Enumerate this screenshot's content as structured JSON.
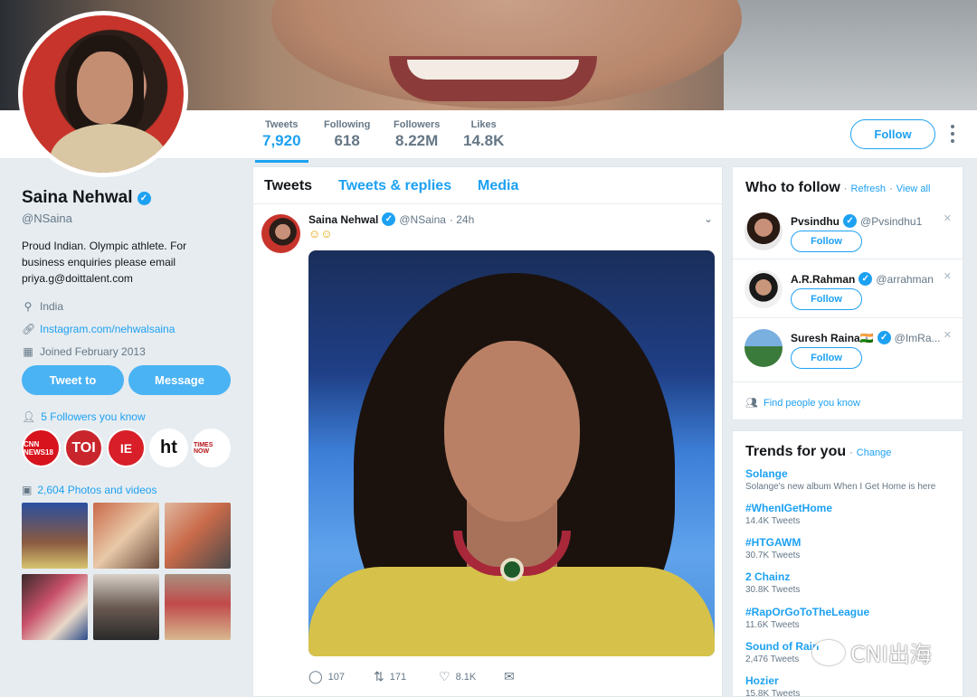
{
  "profile": {
    "name": "Saina Nehwal",
    "handle": "@NSaina",
    "bio": "Proud Indian. Olympic athlete. For business enquiries please email priya.g@doittalent.com",
    "location": "India",
    "website": "Instagram.com/nehwalsaina",
    "joined": "Joined February 2013",
    "tweet_to_label": "Tweet to",
    "message_label": "Message",
    "followers_you_know": "5 Followers you know",
    "photos_videos": "2,604 Photos and videos",
    "badges": [
      "CNN NEWS18",
      "TOI",
      "IE",
      "ht",
      "TIMES NOW"
    ]
  },
  "stats": [
    {
      "label": "Tweets",
      "value": "7,920"
    },
    {
      "label": "Following",
      "value": "618"
    },
    {
      "label": "Followers",
      "value": "8.22M"
    },
    {
      "label": "Likes",
      "value": "14.8K"
    }
  ],
  "follow_label": "Follow",
  "timeline": {
    "tabs": [
      "Tweets",
      "Tweets & replies",
      "Media"
    ],
    "tweet": {
      "name": "Saina Nehwal",
      "handle": "@NSaina",
      "time": "· 24h",
      "text": "☺☺",
      "replies": "107",
      "retweets": "171",
      "likes": "8.1K"
    }
  },
  "who_to_follow": {
    "title": "Who to follow",
    "refresh": "Refresh",
    "view_all": "View all",
    "sep": "·",
    "users": [
      {
        "name": "Pvsindhu",
        "handle": "@Pvsindhu1",
        "follow": "Follow"
      },
      {
        "name": "A.R.Rahman",
        "handle": "@arrahman",
        "follow": "Follow"
      },
      {
        "name": "Suresh Raina🇮🇳",
        "handle": "@ImRa...",
        "follow": "Follow"
      }
    ],
    "find": "Find people you know"
  },
  "trends": {
    "title": "Trends for you",
    "change": "Change",
    "sep": "·",
    "items": [
      {
        "name": "Solange",
        "desc": "Solange's new album When I Get Home is here"
      },
      {
        "name": "#WhenIGetHome",
        "desc": "14.4K Tweets"
      },
      {
        "name": "#HTGAWM",
        "desc": "30.7K Tweets"
      },
      {
        "name": "2 Chainz",
        "desc": "30.8K Tweets"
      },
      {
        "name": "#RapOrGoToTheLeague",
        "desc": "11.6K Tweets"
      },
      {
        "name": "Sound of Rain",
        "desc": "2,476 Tweets"
      },
      {
        "name": "Hozier",
        "desc": "15.8K Tweets"
      }
    ]
  },
  "watermark": "CNI出海",
  "colors": {
    "accent": "#1da1f2",
    "muted": "#657786",
    "background": "#e6ecf0"
  }
}
